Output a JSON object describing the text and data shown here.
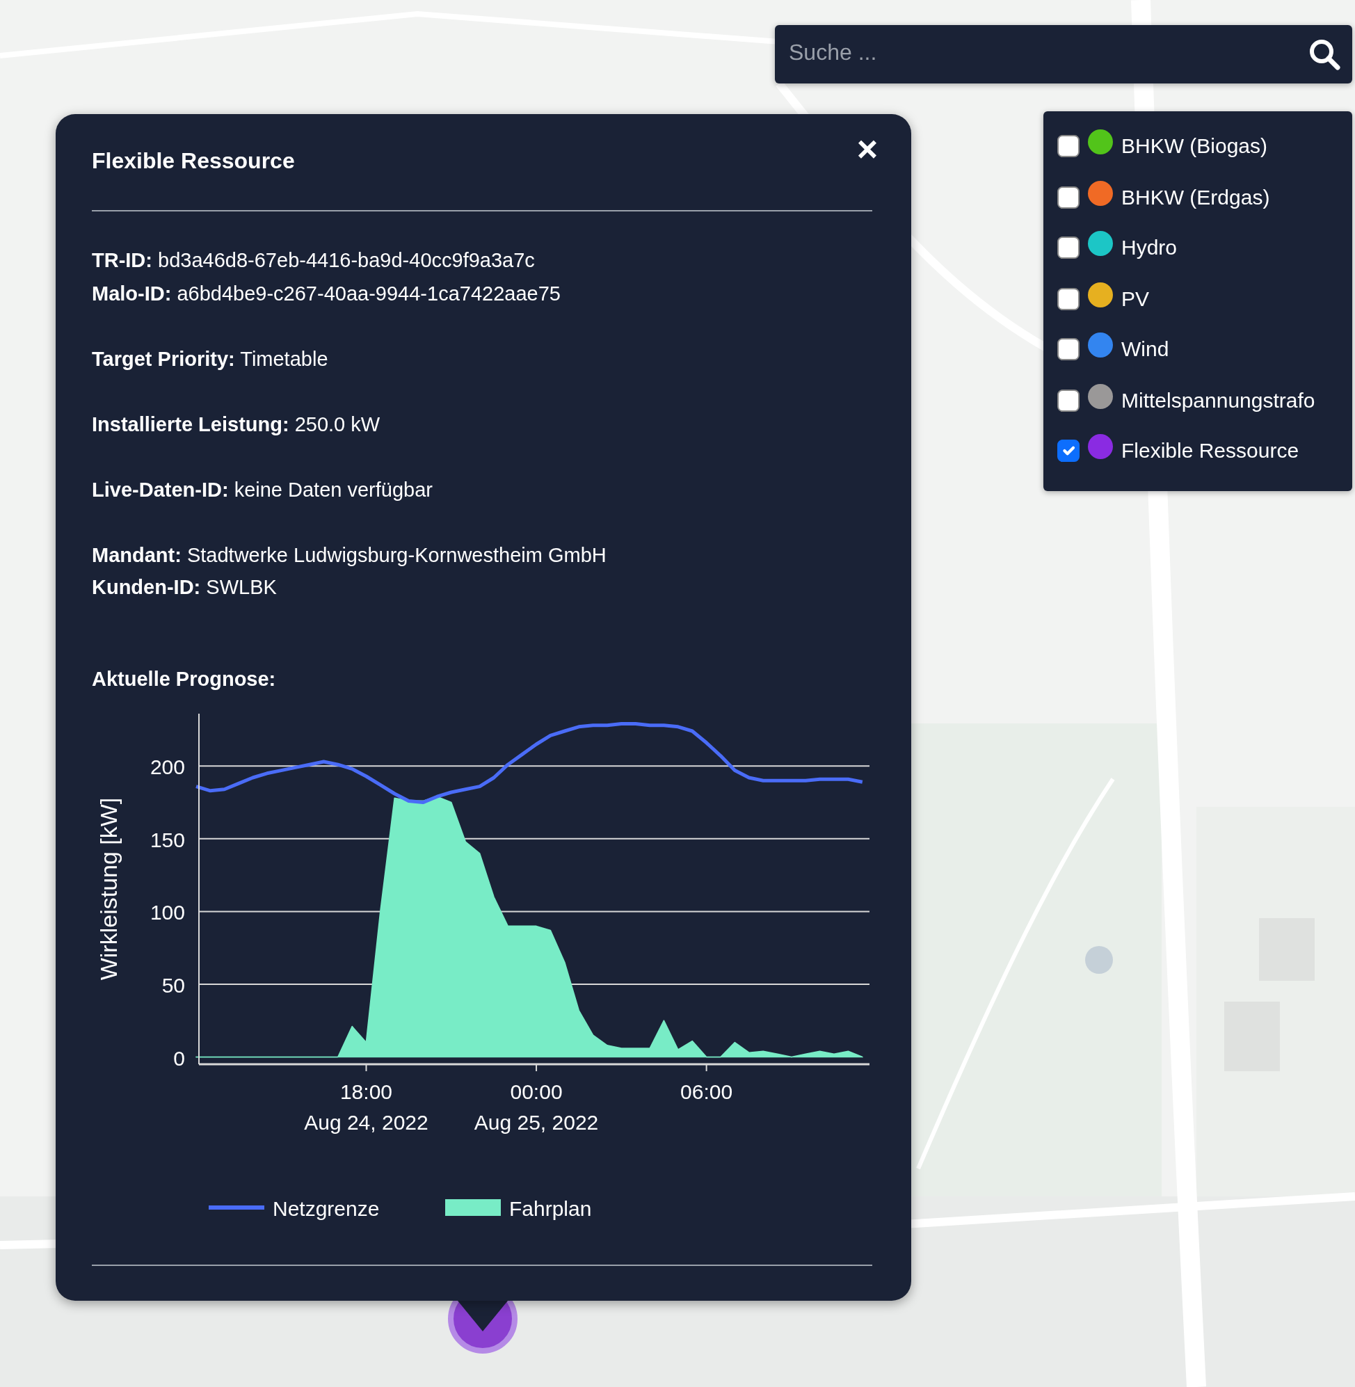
{
  "search": {
    "placeholder": "Suche ..."
  },
  "layers": [
    {
      "label": "BHKW (Biogas)",
      "checked": false,
      "color": "#52c41a"
    },
    {
      "label": "BHKW (Erdgas)",
      "checked": false,
      "color": "#f06a25"
    },
    {
      "label": "Hydro",
      "checked": false,
      "color": "#1cc6c6"
    },
    {
      "label": "PV",
      "checked": false,
      "color": "#e6b020"
    },
    {
      "label": "Wind",
      "checked": false,
      "color": "#3385f0"
    },
    {
      "label": "Mittelspannungstrafo",
      "checked": false,
      "color": "#9a9898"
    },
    {
      "label": "Flexible Ressource",
      "checked": true,
      "color": "#8a2be2"
    }
  ],
  "popup": {
    "title": "Flexible Ressource",
    "close": "×",
    "groups": [
      [
        "**TR-ID:** bd3a46d8-67eb-4416-ba9d-40cc9f9a3a7c",
        "**Malo-ID:** a6bd4be9-c267-40aa-9944-1ca7422aae75"
      ],
      [
        "**Target Priority:** Timetable"
      ],
      [
        "**Installierte Leistung:** 250.0 kW"
      ],
      [
        "**Live-Daten-ID:** keine Daten verfügbar"
      ],
      [
        "**Mandant:** Stadtwerke Ludwigsburg-Kornwestheim GmbH",
        "**Kunden-ID:** SWLBK"
      ]
    ],
    "chart_title": "Aktuelle Prognose:",
    "chart_data": {
      "type": "area",
      "grid": true,
      "legend": "bottom",
      "ylabel": "Wirkleistung [kW]",
      "ylim": [
        -5,
        236
      ],
      "yticks": [
        0,
        50,
        100,
        150,
        200
      ],
      "categories": [
        null,
        null,
        null,
        null,
        null,
        null,
        null,
        null,
        null,
        null,
        null,
        null,
        "18:00\nAug 24, 2022",
        null,
        null,
        null,
        null,
        null,
        null,
        null,
        null,
        null,
        null,
        null,
        "00:00\nAug 25, 2022",
        null,
        null,
        null,
        null,
        null,
        null,
        null,
        null,
        null,
        null,
        null,
        "06:00",
        null,
        null,
        null,
        null,
        null,
        null,
        null,
        null,
        null,
        null,
        null
      ],
      "series": [
        {
          "name": "Netzgrenze",
          "color": "#4a6cf7",
          "type": "line",
          "values": [
            186,
            183,
            184,
            188,
            192,
            195,
            197,
            199,
            201,
            203,
            201,
            198,
            193,
            187,
            181,
            176,
            175,
            179,
            182,
            184,
            186,
            192,
            201,
            208,
            215,
            221,
            224,
            227,
            228,
            228,
            229,
            229,
            228,
            228,
            227,
            224,
            216,
            207,
            197,
            192,
            190,
            190,
            190,
            190,
            191,
            191,
            191,
            189
          ]
        },
        {
          "name": "Fahrplan",
          "color": "#78ecc6",
          "type": "area",
          "values": [
            0,
            0,
            0,
            0,
            0,
            0,
            0,
            0,
            0,
            0,
            0,
            21,
            10,
            100,
            178,
            176,
            176,
            179,
            175,
            148,
            140,
            110,
            90,
            90,
            90,
            87,
            65,
            32,
            15,
            8,
            6,
            6,
            6,
            25,
            5,
            11,
            0,
            0,
            10,
            3,
            4,
            2,
            0,
            2,
            4,
            2,
            4,
            0
          ]
        }
      ]
    }
  }
}
